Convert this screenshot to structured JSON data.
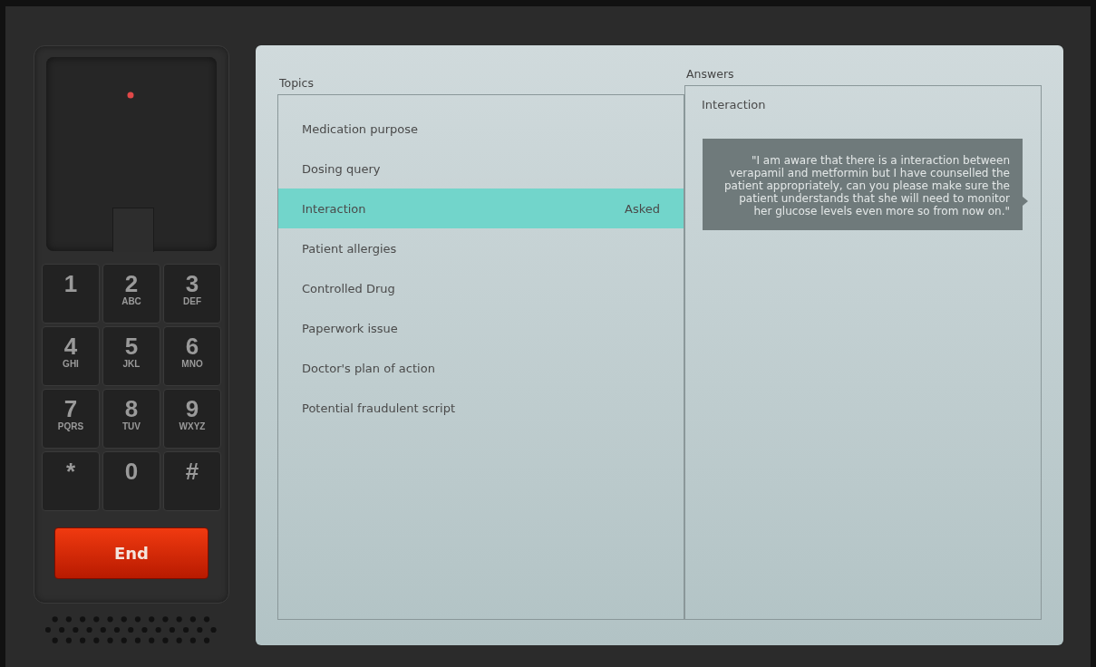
{
  "phone": {
    "keys": [
      {
        "digit": "1"
      },
      {
        "digit": "2",
        "letters": "ABC"
      },
      {
        "digit": "3",
        "letters": "DEF"
      },
      {
        "digit": "4",
        "letters": "GHI"
      },
      {
        "digit": "5",
        "letters": "JKL"
      },
      {
        "digit": "6",
        "letters": "MNO"
      },
      {
        "digit": "7",
        "letters": "PQRS"
      },
      {
        "digit": "8",
        "letters": "TUV"
      },
      {
        "digit": "9",
        "letters": "WXYZ"
      },
      {
        "digit": "*"
      },
      {
        "digit": "0"
      },
      {
        "digit": "#"
      }
    ],
    "end_button": "End"
  },
  "topics": {
    "title": "Topics",
    "items": [
      {
        "label": "Medication purpose",
        "selected": false
      },
      {
        "label": "Dosing query",
        "selected": false
      },
      {
        "label": "Interaction",
        "selected": true,
        "status": "Asked"
      },
      {
        "label": "Patient allergies",
        "selected": false
      },
      {
        "label": "Controlled Drug",
        "selected": false
      },
      {
        "label": "Paperwork issue",
        "selected": false
      },
      {
        "label": "Doctor's plan of action",
        "selected": false
      },
      {
        "label": "Potential fraudulent script",
        "selected": false
      }
    ]
  },
  "answers": {
    "title": "Answers",
    "heading": "Interaction",
    "quote": "\"I am aware that there is a interaction between verapamil and metformin but I have counselled the patient appropriately, can you please make sure the patient understands that she will need to monitor her glucose levels even more so from now on.\""
  }
}
